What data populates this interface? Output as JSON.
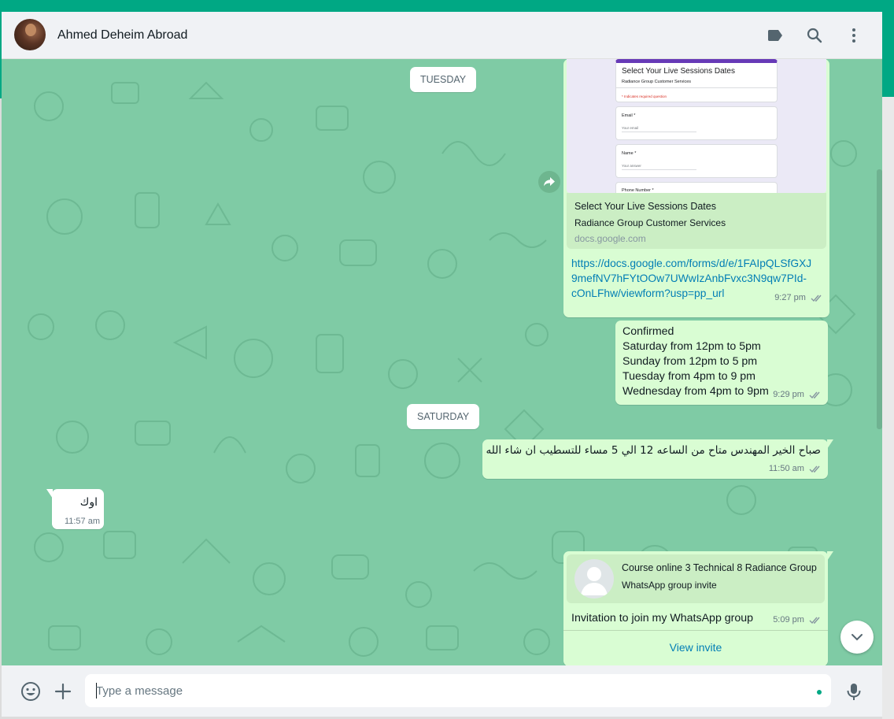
{
  "header": {
    "chat_name": "Ahmed Deheim Abroad"
  },
  "icons": {
    "header": [
      "label-icon",
      "search-icon",
      "menu-dots-icon"
    ],
    "footer": [
      "emoji-icon",
      "plus-icon",
      "microphone-icon"
    ]
  },
  "colors": {
    "accent": "#00a884",
    "wallpaper": "#7fcba5",
    "outgoing_bubble": "#d9fdd3",
    "incoming_bubble": "#ffffff",
    "link": "#027eb5"
  },
  "dates": {
    "tuesday": "TUESDAY",
    "saturday": "SATURDAY"
  },
  "messages": {
    "form_link": {
      "preview_form": {
        "title": "Select Your Live Sessions Dates",
        "subtitle": "Radiance Group Customer Services",
        "required_note": "* Indicates required question",
        "fields": [
          {
            "label": "Email *",
            "placeholder": "Your email"
          },
          {
            "label": "Name *",
            "placeholder": "Your answer"
          },
          {
            "label": "Phone Number *",
            "placeholder": ""
          }
        ]
      },
      "title": "Select Your Live Sessions Dates",
      "description": "Radiance Group Customer Services",
      "domain": "docs.google.com",
      "url_lines": [
        "https://docs.google.com/forms/d/e/1FAIpQLSfGXJ",
        "9mefNV7hFYtOOw7UWwIzAnbFvxc3N9qw7PId-",
        "cOnLFhw/viewform?usp=pp_url"
      ],
      "time": "9:27 pm"
    },
    "confirmed": {
      "lines": [
        "Confirmed",
        "Saturday from 12pm to 5pm",
        "Sunday from 12pm to 5 pm",
        "Tuesday from 4pm to 9 pm",
        "Wednesday from 4pm to 9pm"
      ],
      "time": "9:29 pm"
    },
    "arabic_out": {
      "text": "صباح الخير المهندس متاح من الساعه 12 الي 5 مساء للتسطيب ان شاء الله",
      "time": "11:50 am"
    },
    "arabic_in": {
      "text": "اوك",
      "time": "11:57 am"
    },
    "invite": {
      "group_name": "Course online 3 Technical 8 Radiance Group",
      "invite_type": "WhatsApp group invite",
      "text": "Invitation to join my WhatsApp group",
      "time": "5:09 pm",
      "action": "View invite"
    }
  },
  "composer": {
    "placeholder": "Type a message"
  }
}
